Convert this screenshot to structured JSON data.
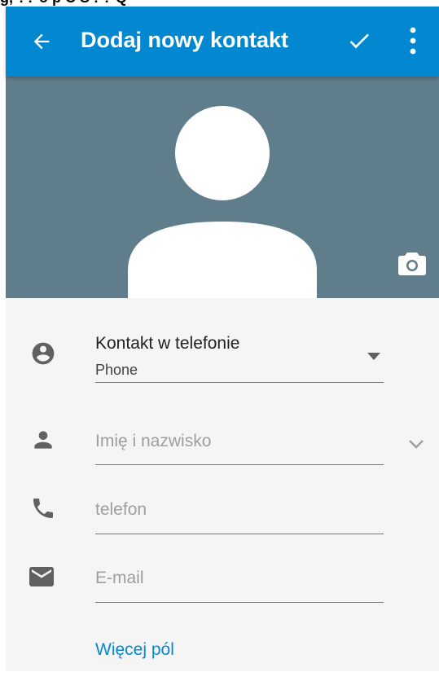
{
  "status_bar": {
    "text": "g, ?? o p C  S  ! ? Q"
  },
  "appbar": {
    "title": "Dodaj nowy kontakt",
    "background": "#0288d1",
    "back_icon": "arrow-back-icon",
    "done_icon": "check-icon",
    "more_icon": "more-vert-icon"
  },
  "photo": {
    "background": "#607d8b",
    "camera_icon": "camera-icon"
  },
  "account": {
    "title": "Kontakt w telefonie",
    "subtitle": "Phone",
    "icon": "account-circle-icon"
  },
  "fields": {
    "name": {
      "placeholder": "Imię i nazwisko",
      "icon": "person-icon"
    },
    "phone": {
      "placeholder": "telefon",
      "icon": "phone-icon"
    },
    "email": {
      "placeholder": "E-mail",
      "icon": "email-icon"
    }
  },
  "more_fields_label": "Więcej pól"
}
